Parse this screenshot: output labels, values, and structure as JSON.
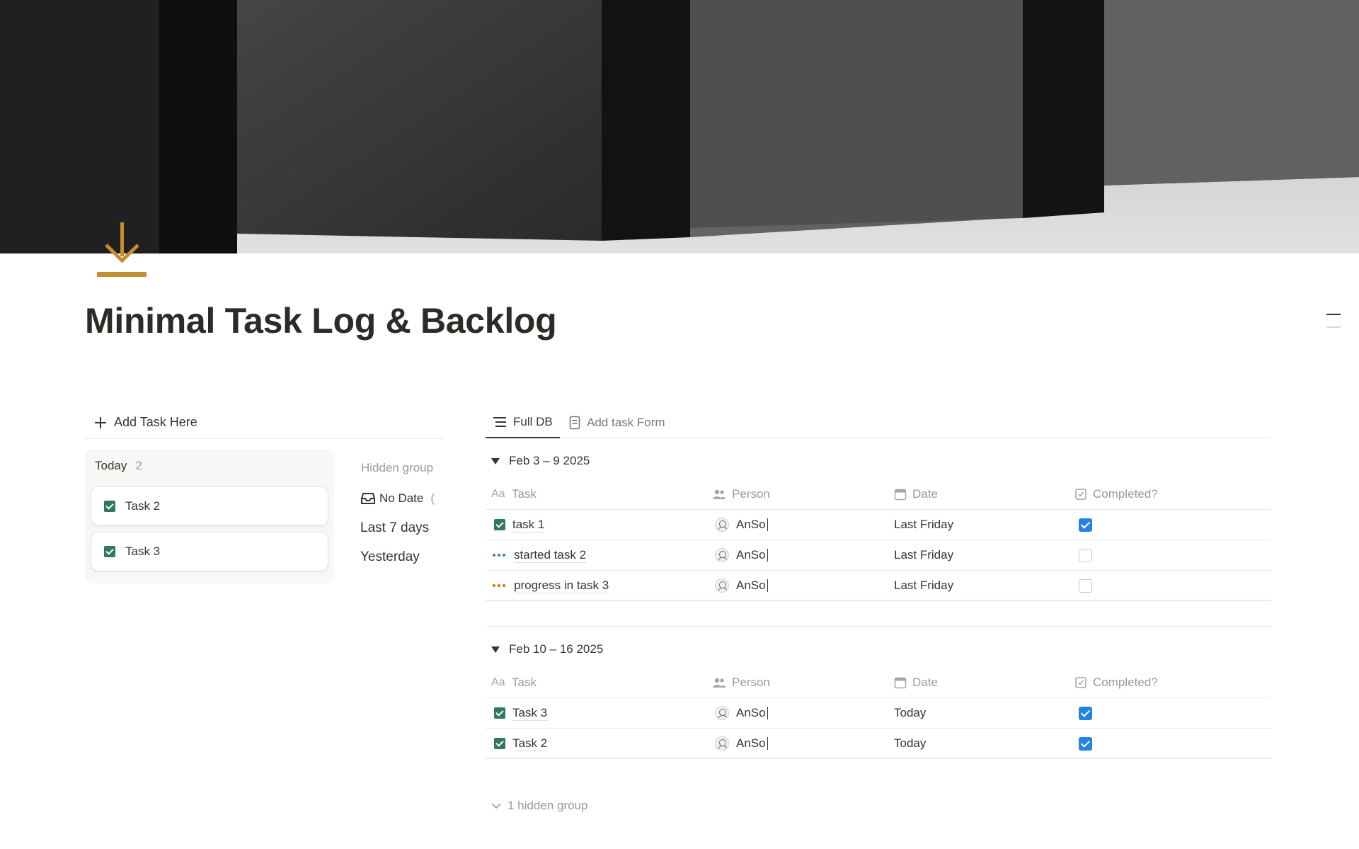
{
  "page": {
    "title": "Minimal Task Log & Backlog",
    "icon": "download-arrow-icon",
    "accent_color": "#c38e2f"
  },
  "quick_add": {
    "label": "Add Task Here"
  },
  "board": {
    "column": {
      "title": "Today",
      "count": "2"
    },
    "cards": [
      {
        "name": "Task 2",
        "status": "done"
      },
      {
        "name": "Task 3",
        "status": "done"
      }
    ],
    "hidden_groups": {
      "header": "Hidden group",
      "items": [
        "No Date",
        "Last 7 days",
        "Yesterday"
      ]
    }
  },
  "database": {
    "tabs": [
      {
        "label": "Full DB",
        "icon": "list-view-icon",
        "active": true
      },
      {
        "label": "Add task Form",
        "icon": "form-icon",
        "active": false
      }
    ],
    "columns": {
      "task": "Task",
      "task_icon": "Aa",
      "person": "Person",
      "date": "Date",
      "completed": "Completed?"
    },
    "groups": [
      {
        "label": "Feb 3 – 9 2025",
        "rows": [
          {
            "task": "task 1",
            "status": "done",
            "person": "AnSo",
            "date": "Last Friday",
            "completed": true
          },
          {
            "task": "started task 2",
            "status": "in-progress",
            "person": "AnSo",
            "date": "Last Friday",
            "completed": false
          },
          {
            "task": "progress in task 3",
            "status": "progress",
            "person": "AnSo",
            "date": "Last Friday",
            "completed": false
          }
        ]
      },
      {
        "label": "Feb 10 – 16 2025",
        "rows": [
          {
            "task": "Task 3",
            "status": "done",
            "person": "AnSo",
            "date": "Today",
            "completed": true
          },
          {
            "task": "Task 2",
            "status": "done",
            "person": "AnSo",
            "date": "Today",
            "completed": true
          }
        ]
      }
    ],
    "hidden_footer": "1 hidden group"
  },
  "colors": {
    "done_green": "#2f7a5a",
    "checkbox_blue": "#2383e2",
    "in_progress_blue": "#337ea9",
    "progress_orange": "#d9730d"
  }
}
